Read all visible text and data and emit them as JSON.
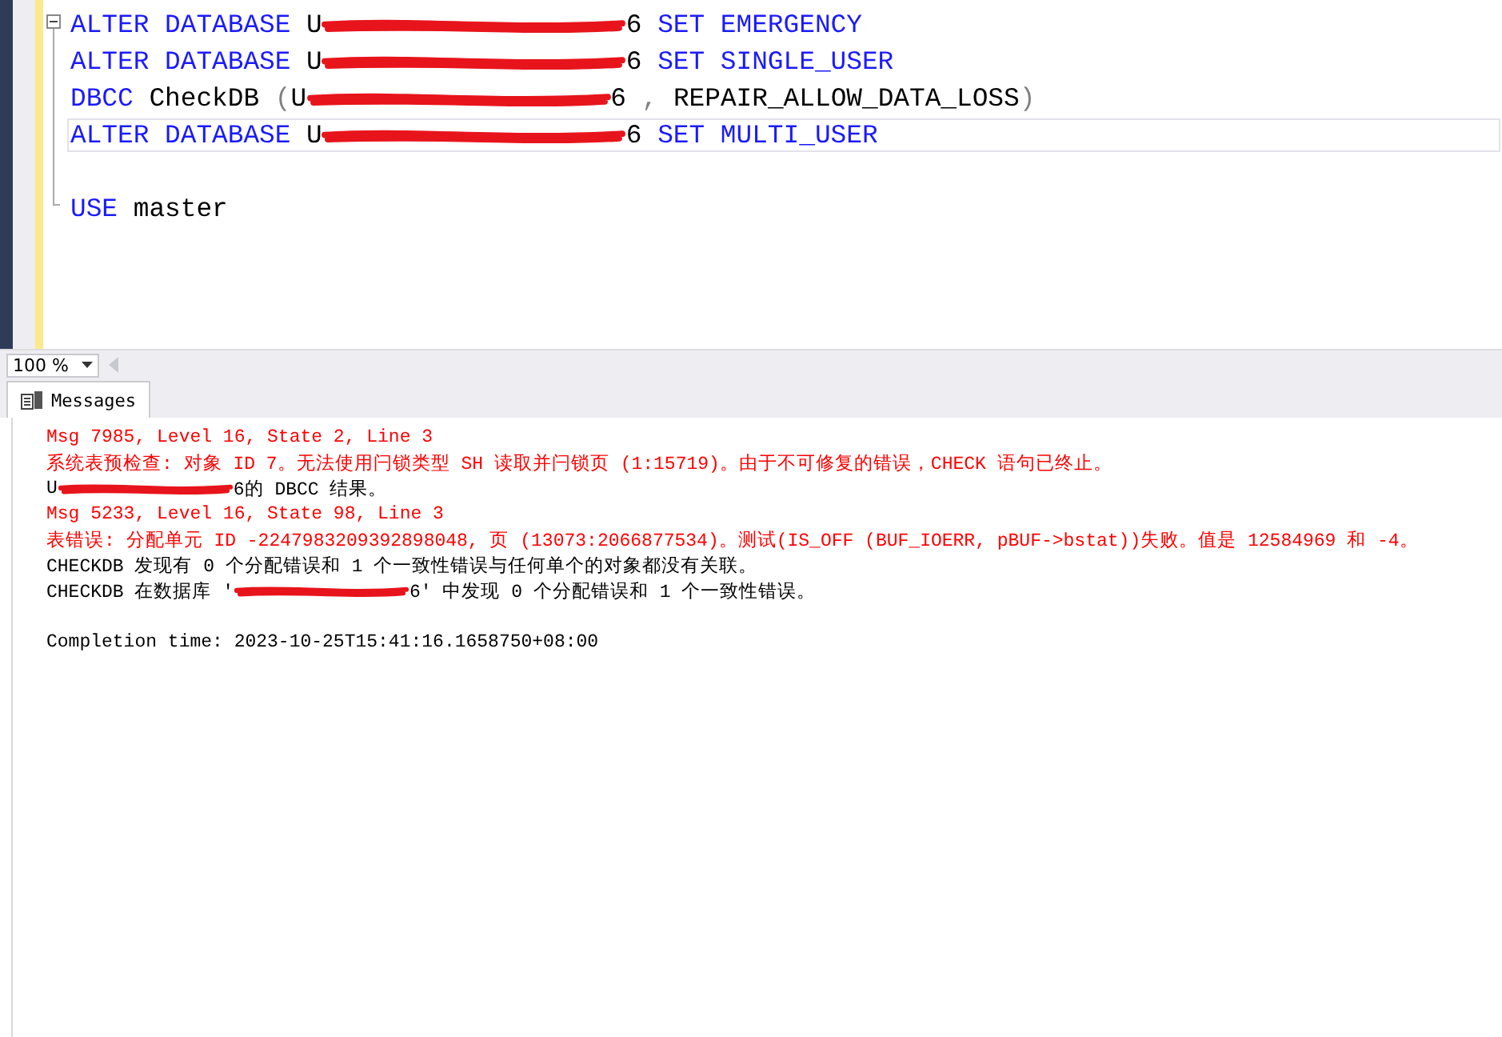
{
  "editor": {
    "lines": [
      {
        "current": false,
        "segments": [
          {
            "kind": "keyword",
            "text": "ALTER DATABASE "
          },
          {
            "kind": "plain",
            "text": "U"
          },
          {
            "kind": "redacted"
          },
          {
            "kind": "plain",
            "text": "6 "
          },
          {
            "kind": "keyword",
            "text": "SET EMERGENCY"
          }
        ]
      },
      {
        "current": false,
        "segments": [
          {
            "kind": "keyword",
            "text": "ALTER DATABASE "
          },
          {
            "kind": "plain",
            "text": "U"
          },
          {
            "kind": "redacted"
          },
          {
            "kind": "plain",
            "text": "6 "
          },
          {
            "kind": "keyword",
            "text": "SET SINGLE_USER"
          }
        ]
      },
      {
        "current": false,
        "segments": [
          {
            "kind": "keyword",
            "text": "DBCC "
          },
          {
            "kind": "plain",
            "text": "CheckDB "
          },
          {
            "kind": "punct",
            "text": "("
          },
          {
            "kind": "plain",
            "text": "U"
          },
          {
            "kind": "redacted"
          },
          {
            "kind": "plain",
            "text": "6 "
          },
          {
            "kind": "punct",
            "text": ", "
          },
          {
            "kind": "plain",
            "text": "REPAIR_ALLOW_DATA_LOSS"
          },
          {
            "kind": "punct",
            "text": ")"
          }
        ]
      },
      {
        "current": true,
        "segments": [
          {
            "kind": "keyword",
            "text": "ALTER DATABASE "
          },
          {
            "kind": "plain",
            "text": "U"
          },
          {
            "kind": "redacted"
          },
          {
            "kind": "plain",
            "text": "6 "
          },
          {
            "kind": "keyword",
            "text": "SET MULTI_USER"
          }
        ]
      },
      {
        "current": false
      },
      {
        "current": false,
        "segments": [
          {
            "kind": "keyword",
            "text": "USE "
          },
          {
            "kind": "plain",
            "text": "master"
          }
        ]
      }
    ]
  },
  "zoom": {
    "value": "100 %"
  },
  "tabs": [
    {
      "label": "Messages",
      "selected": true
    }
  ],
  "messages": [
    {
      "kind": "error",
      "segments": [
        {
          "kind": "text",
          "text": "Msg 7985, Level 16, State 2, Line 3"
        }
      ]
    },
    {
      "kind": "error",
      "segments": [
        {
          "kind": "text",
          "text": "系统表预检查: 对象 ID 7。无法使用闩锁类型 SH 读取并闩锁页 (1:15719)。由于不可修复的错误，CHECK 语句已终止。"
        }
      ]
    },
    {
      "kind": "info",
      "segments": [
        {
          "kind": "text",
          "text": "U"
        },
        {
          "kind": "redacted"
        },
        {
          "kind": "text",
          "text": "6的 DBCC 结果。"
        }
      ]
    },
    {
      "kind": "error",
      "segments": [
        {
          "kind": "text",
          "text": "Msg 5233, Level 16, State 98, Line 3"
        }
      ]
    },
    {
      "kind": "error",
      "segments": [
        {
          "kind": "text",
          "text": "表错误: 分配单元 ID -2247983209392898048, 页 (13073:2066877534)。测试(IS_OFF (BUF_IOERR, pBUF->bstat))失败。值是 12584969 和 -4。"
        }
      ]
    },
    {
      "kind": "info",
      "segments": [
        {
          "kind": "text",
          "text": "CHECKDB 发现有 0 个分配错误和 1 个一致性错误与任何单个的对象都没有关联。"
        }
      ]
    },
    {
      "kind": "info",
      "segments": [
        {
          "kind": "text",
          "text": "CHECKDB 在数据库 '"
        },
        {
          "kind": "redacted"
        },
        {
          "kind": "text",
          "text": "6' 中发现 0 个分配错误和 1 个一致性错误。"
        }
      ]
    },
    {
      "kind": "blank"
    },
    {
      "kind": "info",
      "segments": [
        {
          "kind": "text",
          "text": "Completion time: 2023-10-25T15:41:16.1658750+08:00"
        }
      ]
    }
  ]
}
